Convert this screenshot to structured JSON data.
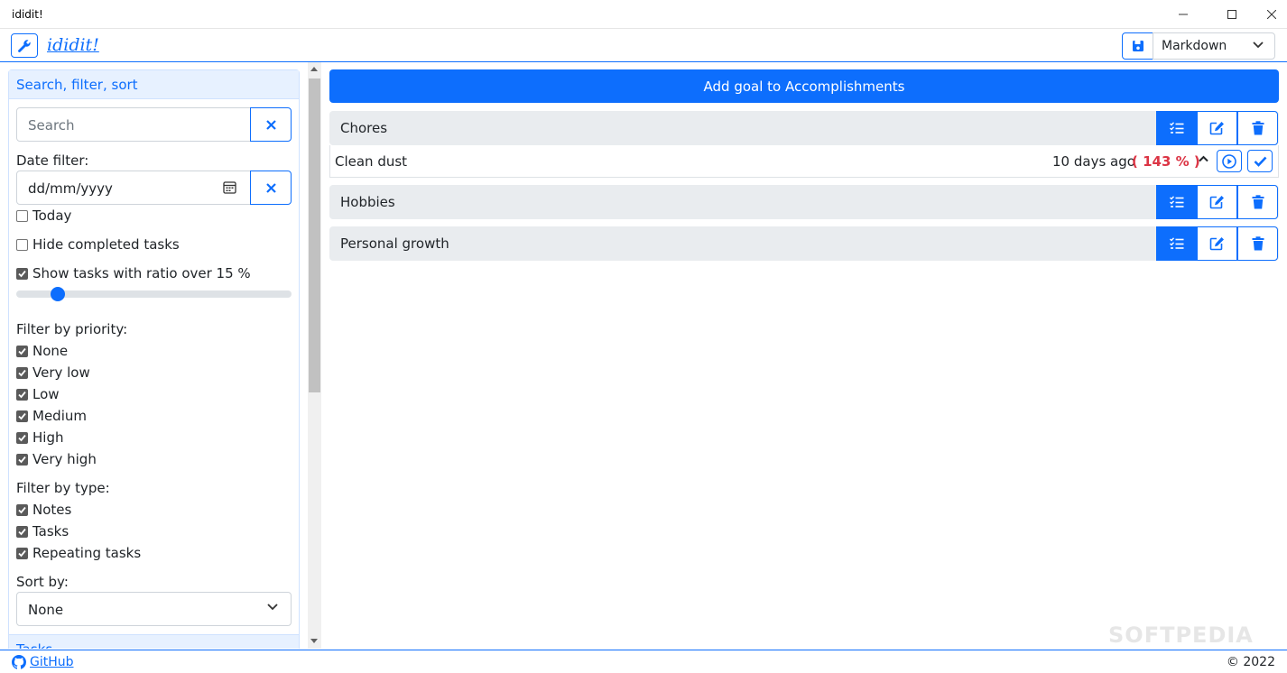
{
  "window": {
    "title": "ididit!"
  },
  "header": {
    "app_name": "ididit!",
    "export_format": "Markdown"
  },
  "sidebar": {
    "panel_title": "Search, filter, sort",
    "search_placeholder": "Search",
    "date_filter_label": "Date filter:",
    "date_placeholder": "dd/mm/yyyy",
    "today_label": "Today",
    "hide_completed_label": "Hide completed tasks",
    "ratio_label": "Show tasks with ratio over 15 %",
    "ratio_value_pct": 15,
    "priority_label": "Filter by priority:",
    "priorities": [
      "None",
      "Very low",
      "Low",
      "Medium",
      "High",
      "Very high"
    ],
    "type_label": "Filter by type:",
    "types": [
      "Notes",
      "Tasks",
      "Repeating tasks"
    ],
    "sort_label": "Sort by:",
    "sort_value": "None",
    "next_panel_title": "Tasks"
  },
  "main": {
    "add_goal_label": "Add goal to Accomplishments",
    "goals": [
      {
        "name": "Chores"
      },
      {
        "name": "Hobbies"
      },
      {
        "name": "Personal growth"
      }
    ],
    "task": {
      "name": "Clean dust",
      "ago": "10 days ago",
      "ratio": "( 143 % )"
    }
  },
  "footer": {
    "github": "GitHub",
    "copyright": "© 2022"
  },
  "watermark": "SOFTPEDIA",
  "colors": {
    "primary": "#0d6efd",
    "danger": "#dc3545",
    "goal_bg": "#e9ecef"
  }
}
